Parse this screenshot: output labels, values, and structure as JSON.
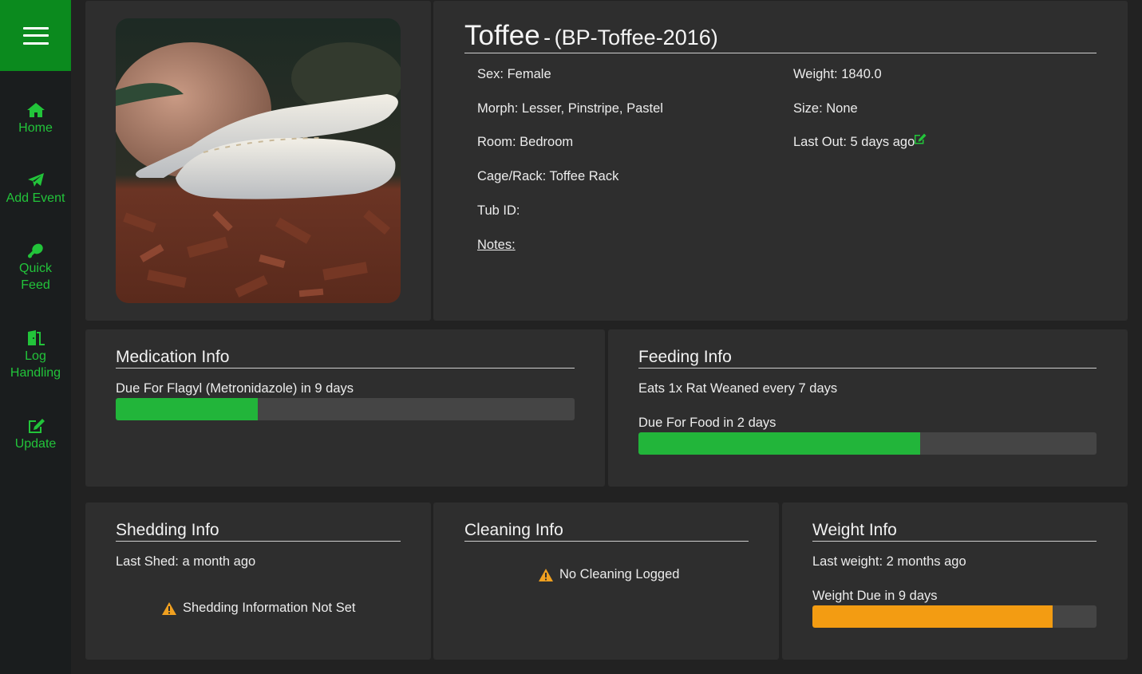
{
  "sidebar": {
    "menu_icon": "hamburger-menu-icon",
    "items": [
      {
        "label_lines": [
          "Home"
        ],
        "icon": "home-icon"
      },
      {
        "label_lines": [
          "Add Event"
        ],
        "icon": "paper-plane-icon"
      },
      {
        "label_lines": [
          "Quick",
          "Feed"
        ],
        "icon": "drumstick-icon"
      },
      {
        "label_lines": [
          "Log",
          "Handling"
        ],
        "icon": "door-exit-icon"
      },
      {
        "label_lines": [
          "Update"
        ],
        "icon": "edit-icon"
      }
    ]
  },
  "profile": {
    "name": "Toffee",
    "separator": "-",
    "tag": "(BP-Toffee-2016)",
    "photo": "ball-python-photo",
    "left_fields": [
      "Sex: Female",
      "Morph: Lesser, Pinstripe, Pastel",
      "Room: Bedroom",
      "Cage/Rack: Toffee Rack",
      "Tub ID:"
    ],
    "notes_label": "Notes:",
    "right_fields": [
      "Weight: 1840.0",
      "Size: None",
      "Last Out: 5 days ago"
    ]
  },
  "medication": {
    "title": "Medication Info",
    "due_text": "Due For Flagyl (Metronidazole) in 9 days",
    "progress": 0.31
  },
  "feeding": {
    "title": "Feeding Info",
    "schedule_text": "Eats 1x Rat Weaned every 7 days",
    "due_text": "Due For Food in 2 days",
    "progress": 0.615
  },
  "shedding": {
    "title": "Shedding Info",
    "last_text": "Last Shed: a month ago",
    "warning_text": "Shedding Information Not Set"
  },
  "cleaning": {
    "title": "Cleaning Info",
    "warning_text": "No Cleaning Logged"
  },
  "weight": {
    "title": "Weight Info",
    "last_text": "Last weight: 2 months ago",
    "due_text": "Weight Due in 9 days",
    "progress": 0.845
  },
  "colors": {
    "accent_green": "#22c43a",
    "menu_green": "#0b8a1e",
    "bar_green": "#22b53a",
    "bar_orange": "#f39c12",
    "warning_orange": "#f0a020",
    "panel": "#2e2e2e",
    "background": "#222222"
  }
}
